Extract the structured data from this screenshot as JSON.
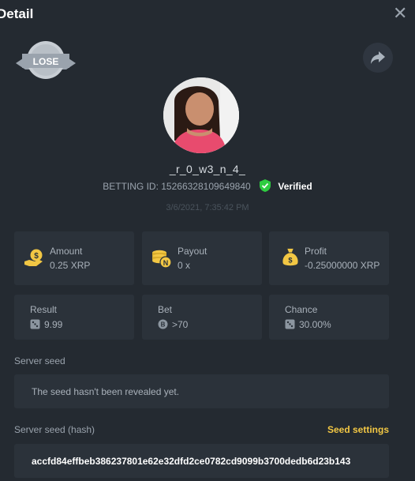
{
  "dialog": {
    "title": "Detail",
    "close_label": "✕"
  },
  "result_badge": {
    "text": "LOSE"
  },
  "player": {
    "username": "_r_0_w3_n_4_",
    "betting_id_label": "BETTING ID:",
    "betting_id": "1526632810964984​0",
    "verified_label": "Verified",
    "date": "3/6/2021, 7:35:42 PM"
  },
  "stats": {
    "amount": {
      "label": "Amount",
      "value": "0.25 XRP"
    },
    "payout": {
      "label": "Payout",
      "value": "0 x"
    },
    "profit": {
      "label": "Profit",
      "value": "-0.25000000 XRP"
    },
    "result": {
      "label": "Result",
      "value": "9.99"
    },
    "bet": {
      "label": "Bet",
      "value": ">70"
    },
    "chance": {
      "label": "Chance",
      "value": "30.00%"
    }
  },
  "server_seed": {
    "label": "Server seed",
    "message": "The seed hasn't been revealed yet."
  },
  "server_seed_hash": {
    "label": "Server seed (hash)",
    "settings_link": "Seed settings",
    "value": "accfd84effbeb386237801e62e32dfd2ce0782cd9099b3700dedb6d23b143"
  },
  "colors": {
    "accent": "#f2c744",
    "verified": "#2ecc40",
    "background": "#242a31",
    "card": "#2b323a"
  }
}
